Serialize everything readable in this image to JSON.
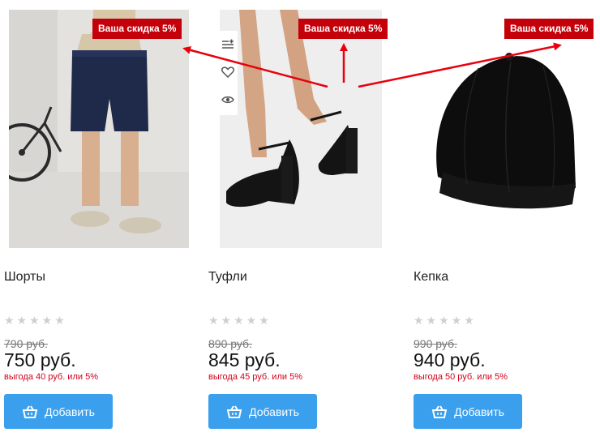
{
  "badge_text": "Ваша скидка 5%",
  "products": [
    {
      "title": "Шорты",
      "stars": "★★★★★",
      "old_price": "790 руб.",
      "price": "750 руб.",
      "savings": "выгода 40 руб. или 5%",
      "button": "Добавить",
      "image": "man-in-navy-shorts-with-bicycle"
    },
    {
      "title": "Туфли",
      "stars": "★★★★★",
      "old_price": "890 руб.",
      "price": "845 руб.",
      "savings": "выгода 45 руб. или 5%",
      "button": "Добавить",
      "image": "black-ankle-strap-heels"
    },
    {
      "title": "Кепка",
      "stars": "★★★★★",
      "old_price": "990 руб.",
      "price": "940 руб.",
      "savings": "выгода 50 руб. или 5%",
      "button": "Добавить",
      "image": "black-baseball-cap"
    }
  ],
  "icons": {
    "compare": "add-to-compare-icon",
    "wishlist": "heart-icon",
    "quick_view": "eye-icon",
    "cart": "basket-icon"
  },
  "colors": {
    "badge": "#c4000b",
    "button": "#3aa0ed",
    "savings": "#d0021b",
    "arrow": "#e8000d"
  }
}
